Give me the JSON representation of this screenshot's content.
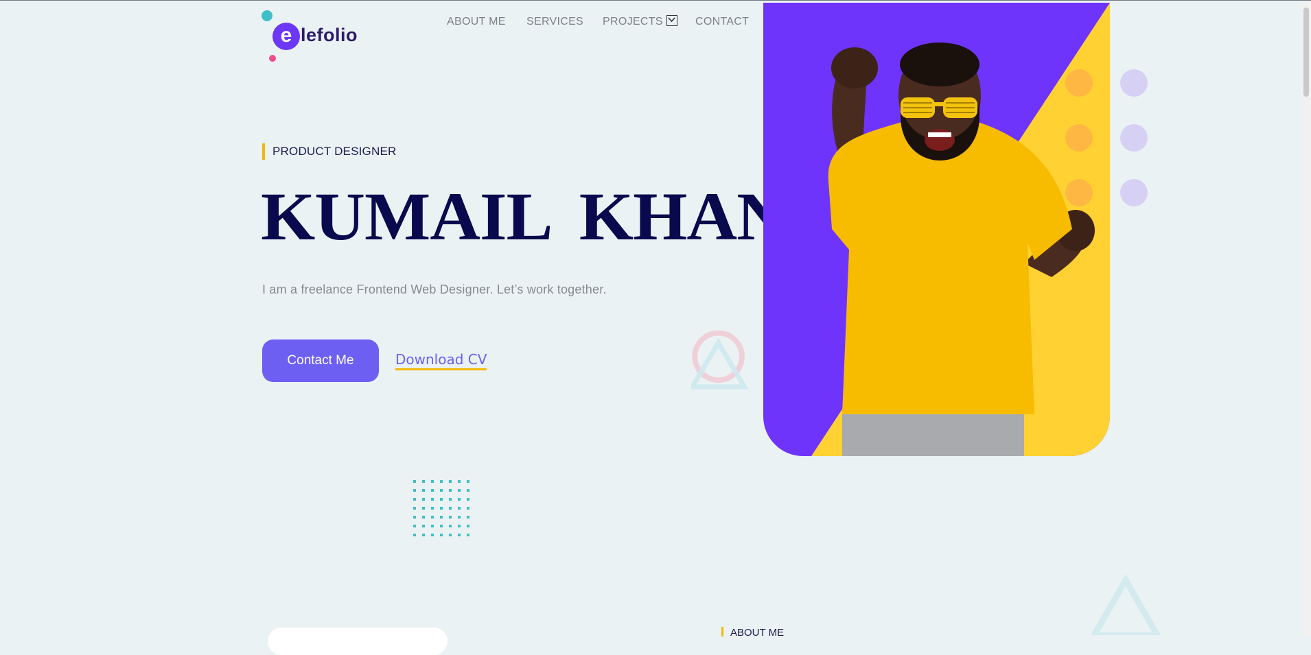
{
  "brand": {
    "logo_letter": "e",
    "logo_rest": "lefolio",
    "accent": "#6c37f5",
    "navy": "#09094d",
    "yellow": "#f5b800"
  },
  "nav": {
    "items": [
      {
        "label": "ABOUT ME"
      },
      {
        "label": "SERVICES"
      },
      {
        "label": "PROJECTS",
        "has_dropdown": true
      },
      {
        "label": "CONTACT"
      }
    ]
  },
  "hero": {
    "eyebrow": "PRODUCT DESIGNER",
    "name": "KUMAIL KHAN",
    "tagline": "I am a freelance Frontend Web Designer. Let’s work together.",
    "primary_button": "Contact Me",
    "secondary_link": "Download CV"
  },
  "next_section": {
    "eyebrow": "ABOUT ME"
  },
  "icons": {
    "dropdown": "chevron-down-icon"
  }
}
